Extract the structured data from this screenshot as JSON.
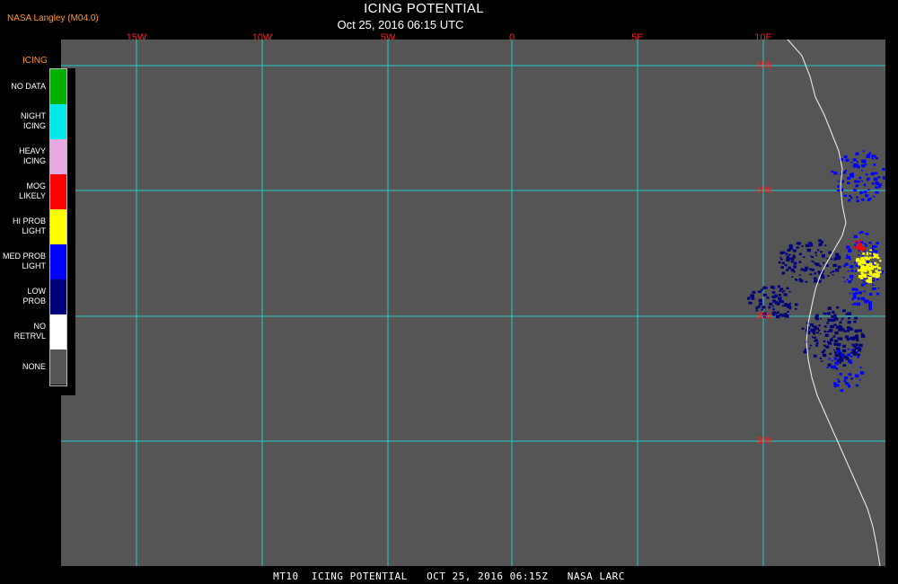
{
  "header": {
    "credit": "NASA Langley (M04.0)",
    "title": "ICING POTENTIAL",
    "subtitle": "Oct 25, 2016 06:15 UTC"
  },
  "map": {
    "background_color": "#555555",
    "grid_color": "#22cccc",
    "coastline_color": "#e8e8e8",
    "longitude_labels": [
      "15W",
      "10W",
      "5W",
      "0",
      "5E",
      "10E"
    ],
    "latitude_labels": [
      "45N",
      "40N",
      "35N",
      "30N"
    ],
    "label_color": "#ff2020"
  },
  "legend": {
    "title": "ICING",
    "items": [
      {
        "label": "NO DATA",
        "color": "#00b000"
      },
      {
        "label": "NIGHT\nICING",
        "color": "#00e8e8"
      },
      {
        "label": "HEAVY\nICING",
        "color": "#e8a8e0"
      },
      {
        "label": "MOG\nLIKELY",
        "color": "#ff0000"
      },
      {
        "label": "HI PROB\nLIGHT",
        "color": "#ffff00"
      },
      {
        "label": "MED PROB\nLIGHT",
        "color": "#0000ff"
      },
      {
        "label": "LOW\nPROB",
        "color": "#00007a"
      },
      {
        "label": "NO\nRETRVL",
        "color": "#ffffff"
      },
      {
        "label": "NONE",
        "color": "#555555"
      }
    ]
  },
  "footer": {
    "caption": "MT10  ICING POTENTIAL   OCT 25, 2016 06:15Z   NASA LARC"
  }
}
